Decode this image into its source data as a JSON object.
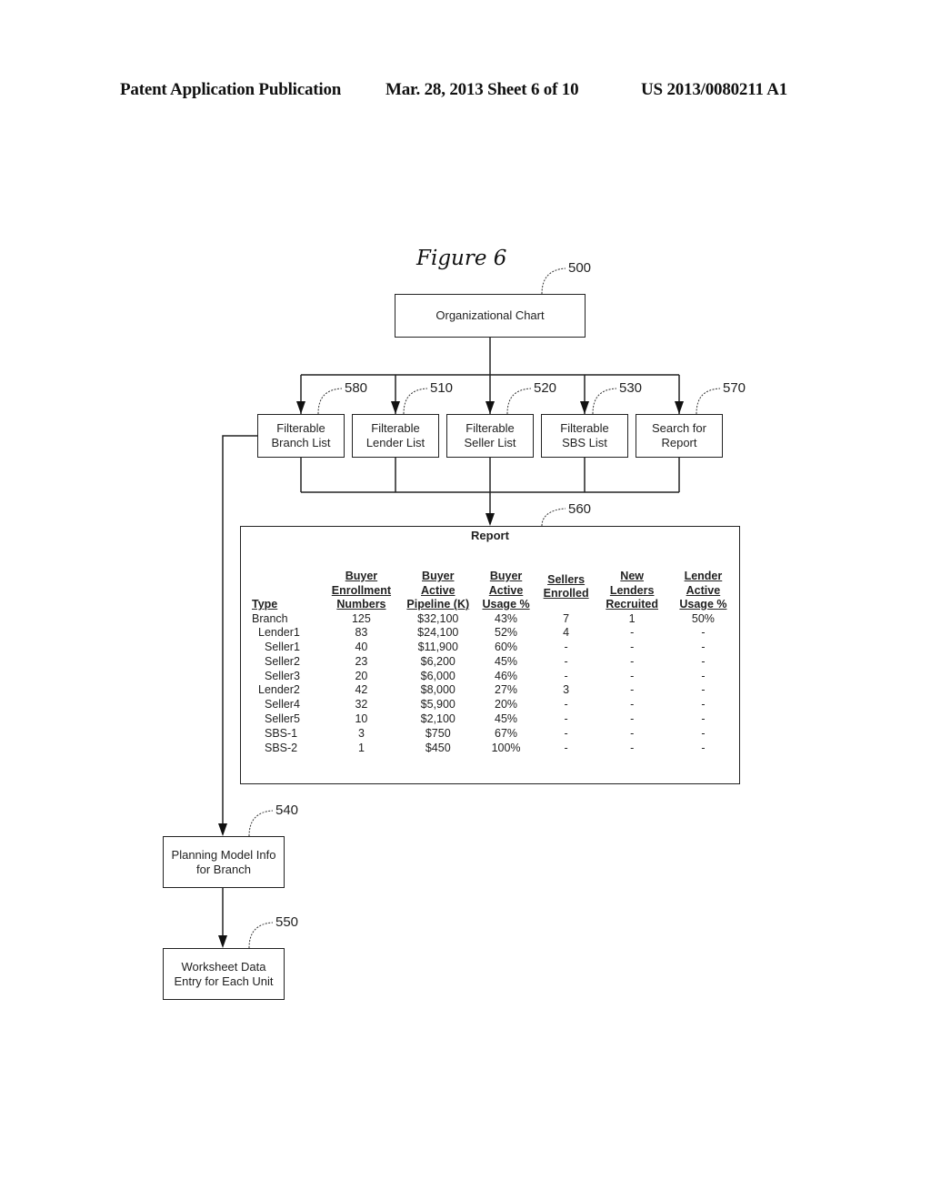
{
  "header": {
    "publication_label": "Patent Application Publication",
    "date_sheet": "Mar. 28, 2013  Sheet 6 of 10",
    "patent_number": "US 2013/0080211 A1"
  },
  "figure": {
    "title": "Figure 6"
  },
  "nodes": {
    "org_chart": {
      "ref": "500",
      "lines": [
        "Organizational Chart"
      ]
    },
    "branch_list": {
      "ref": "580",
      "lines": [
        "Filterable",
        "Branch List"
      ]
    },
    "lender_list": {
      "ref": "510",
      "lines": [
        "Filterable",
        "Lender List"
      ]
    },
    "seller_list": {
      "ref": "520",
      "lines": [
        "Filterable",
        "Seller List"
      ]
    },
    "sbs_list": {
      "ref": "530",
      "lines": [
        "Filterable",
        "SBS List"
      ]
    },
    "search_report": {
      "ref": "570",
      "lines": [
        "Search for",
        "Report"
      ]
    },
    "planning_model": {
      "ref": "540",
      "lines": [
        "Planning Model Info",
        "for Branch"
      ]
    },
    "worksheet": {
      "ref": "550",
      "lines": [
        "Worksheet Data",
        "Entry for Each Unit"
      ]
    }
  },
  "report": {
    "ref": "560",
    "title": "Report",
    "columns": [
      {
        "lines": [
          "Type"
        ]
      },
      {
        "lines": [
          "Buyer",
          "Enrollment",
          "Numbers"
        ]
      },
      {
        "lines": [
          "Buyer",
          "Active",
          "Pipeline (K)"
        ]
      },
      {
        "lines": [
          "Buyer",
          "Active",
          "Usage %"
        ]
      },
      {
        "lines": [
          "Sellers",
          "Enrolled"
        ]
      },
      {
        "lines": [
          "New",
          "Lenders",
          "Recruited"
        ]
      },
      {
        "lines": [
          "Lender",
          "Active",
          "Usage %"
        ]
      }
    ],
    "rows": [
      {
        "level": 0,
        "cells": [
          "Branch",
          "125",
          "$32,100",
          "43%",
          "7",
          "1",
          "50%"
        ]
      },
      {
        "level": 1,
        "cells": [
          "Lender1",
          "83",
          "$24,100",
          "52%",
          "4",
          "-",
          "-"
        ]
      },
      {
        "level": 2,
        "cells": [
          "Seller1",
          "40",
          "$11,900",
          "60%",
          "-",
          "-",
          "-"
        ]
      },
      {
        "level": 2,
        "cells": [
          "Seller2",
          "23",
          "$6,200",
          "45%",
          "-",
          "-",
          "-"
        ]
      },
      {
        "level": 2,
        "cells": [
          "Seller3",
          "20",
          "$6,000",
          "46%",
          "-",
          "-",
          "-"
        ]
      },
      {
        "level": 1,
        "cells": [
          "Lender2",
          "42",
          "$8,000",
          "27%",
          "3",
          "-",
          "-"
        ]
      },
      {
        "level": 2,
        "cells": [
          "Seller4",
          "32",
          "$5,900",
          "20%",
          "-",
          "-",
          "-"
        ]
      },
      {
        "level": 2,
        "cells": [
          "Seller5",
          "10",
          "$2,100",
          "45%",
          "-",
          "-",
          "-"
        ]
      },
      {
        "level": 2,
        "cells": [
          "SBS-1",
          "3",
          "$750",
          "67%",
          "-",
          "-",
          "-"
        ]
      },
      {
        "level": 2,
        "cells": [
          "SBS-2",
          "1",
          "$450",
          "100%",
          "-",
          "-",
          "-"
        ]
      }
    ]
  }
}
